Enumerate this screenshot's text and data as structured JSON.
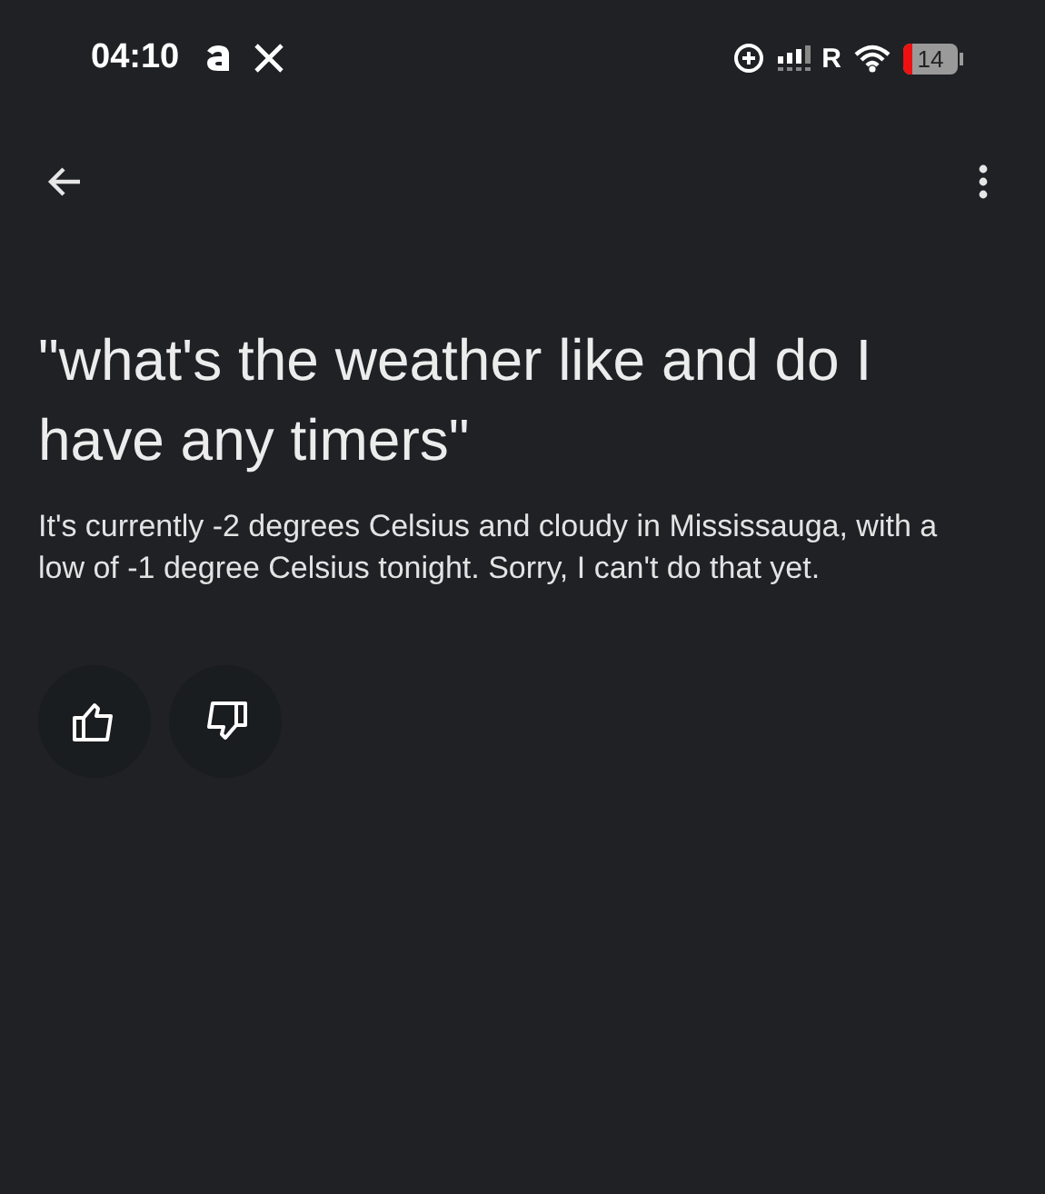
{
  "status_bar": {
    "time": "04:10",
    "network_label": "R",
    "battery": "14"
  },
  "query": "\"what's the weather like and do I have any timers\"",
  "response": "It's currently -2 degrees Celsius and cloudy in Mississauga, with a low of -1 degree Celsius tonight. Sorry, I can't do that yet."
}
